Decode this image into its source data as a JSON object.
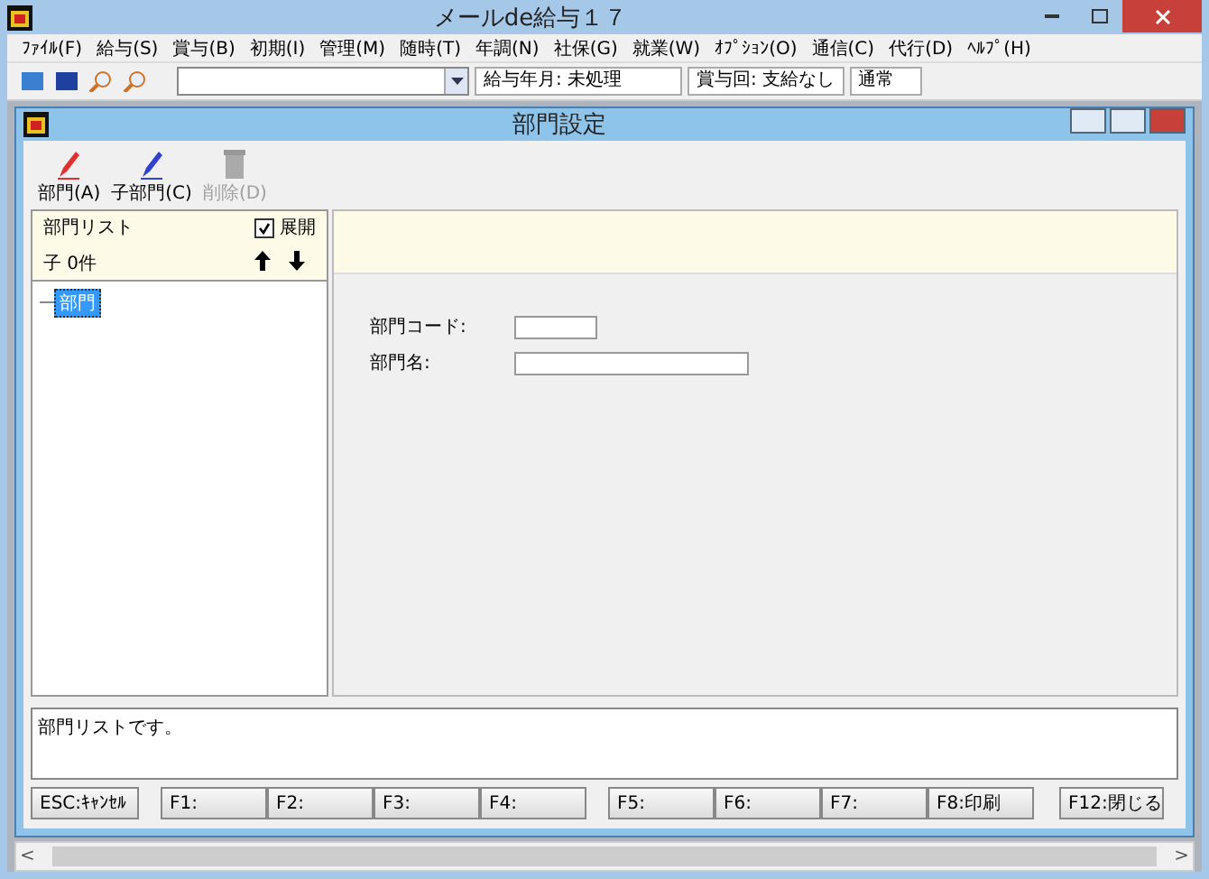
{
  "window": {
    "title": "メールde給与１７"
  },
  "menu": [
    "ﾌｧｲﾙ(F)",
    "給与(S)",
    "賞与(B)",
    "初期(I)",
    "管理(M)",
    "随時(T)",
    "年調(N)",
    "社保(G)",
    "就業(W)",
    "ｵﾌﾟｼｮﾝ(O)",
    "通信(C)",
    "代行(D)",
    "ﾍﾙﾌﾟ(H)"
  ],
  "toolbar": {
    "period": "給与年月: 未処理",
    "bonus": "賞与回: 支給なし",
    "mode": "通常"
  },
  "dialog": {
    "title": "部門設定",
    "actions": [
      {
        "label": "部門(A)",
        "kind": "red-pen",
        "disabled": false
      },
      {
        "label": "子部門(C)",
        "kind": "blue-pen",
        "disabled": false
      },
      {
        "label": "削除(D)",
        "kind": "trash",
        "disabled": true
      }
    ],
    "list": {
      "title": "部門リスト",
      "expand": {
        "label": "展開",
        "checked": true
      },
      "count": "子 0件",
      "items": [
        {
          "label": "部門",
          "selected": true
        }
      ]
    },
    "form": [
      {
        "label": "部門コード:"
      },
      {
        "label": "部門名:"
      }
    ],
    "message": "部門リストです。",
    "keys": [
      "ESC:ｷｬﾝｾﾙ",
      "F1:",
      "F2:",
      "F3:",
      "F4:",
      "F5:",
      "F6:",
      "F7:",
      "F8:印刷",
      "F12:閉じる"
    ]
  },
  "scrollbar": {
    "left": "<",
    "right": ">"
  }
}
